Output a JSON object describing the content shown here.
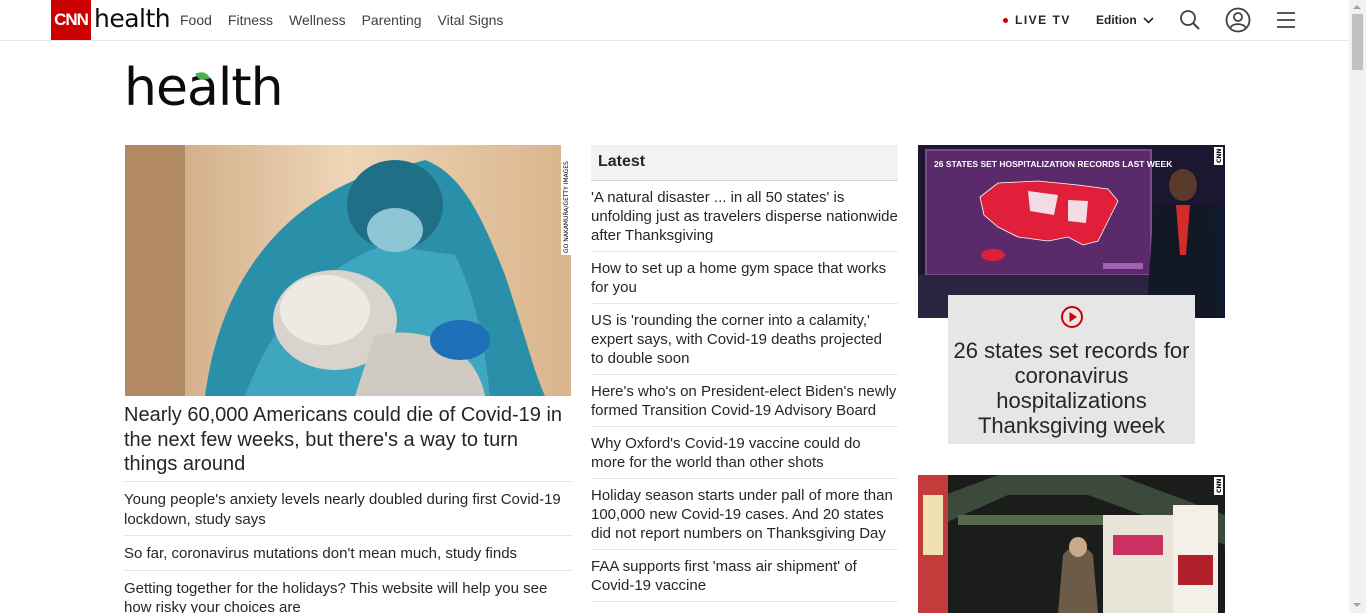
{
  "nav": {
    "brand": "CNN",
    "section": "health",
    "links": [
      "Food",
      "Fitness",
      "Wellness",
      "Parenting",
      "Vital Signs"
    ],
    "live_tv": "LIVE TV",
    "edition": "Edition"
  },
  "page_logo": "health",
  "hero": {
    "photo_credit": "GO NAKAMURA/GETTY IMAGES",
    "title": "Nearly 60,000 Americans could die of Covid-19 in the next few weeks, but there's a way to turn things around"
  },
  "col1_stories": [
    "Young people's anxiety levels nearly doubled during first Covid-19 lockdown, study says",
    "So far, coronavirus mutations don't mean much, study finds",
    "Getting together for the holidays? This website will help you see how risky your choices are"
  ],
  "latest": {
    "heading": "Latest",
    "items": [
      "'A natural disaster ... in all 50 states' is unfolding just as travelers disperse nationwide after Thanksgiving",
      "How to set up a home gym space that works for you",
      "US is 'rounding the corner into a calamity,' expert says, with Covid-19 deaths projected to double soon",
      "Here's who's on President-elect Biden's newly formed Transition Covid-19 Advisory Board",
      "Why Oxford's Covid-19 vaccine could do more for the world than other shots",
      "Holiday season starts under pall of more than 100,000 new Covid-19 cases. And 20 states did not report numbers on Thanksgiving Day",
      "FAA supports first 'mass air shipment' of Covid-19 vaccine"
    ]
  },
  "video": {
    "screen_headline": "26 STATES SET HOSPITALIZATION RECORDS LAST WEEK",
    "badge": "CNN",
    "caption": "26 states set records for coronavirus hospitalizations Thanksgiving week"
  },
  "photo2": {
    "badge": "CNN"
  },
  "colors": {
    "cnn_red": "#cc0000",
    "caption_bg": "#e6e6e6",
    "latest_bg": "#f2f2f2"
  }
}
